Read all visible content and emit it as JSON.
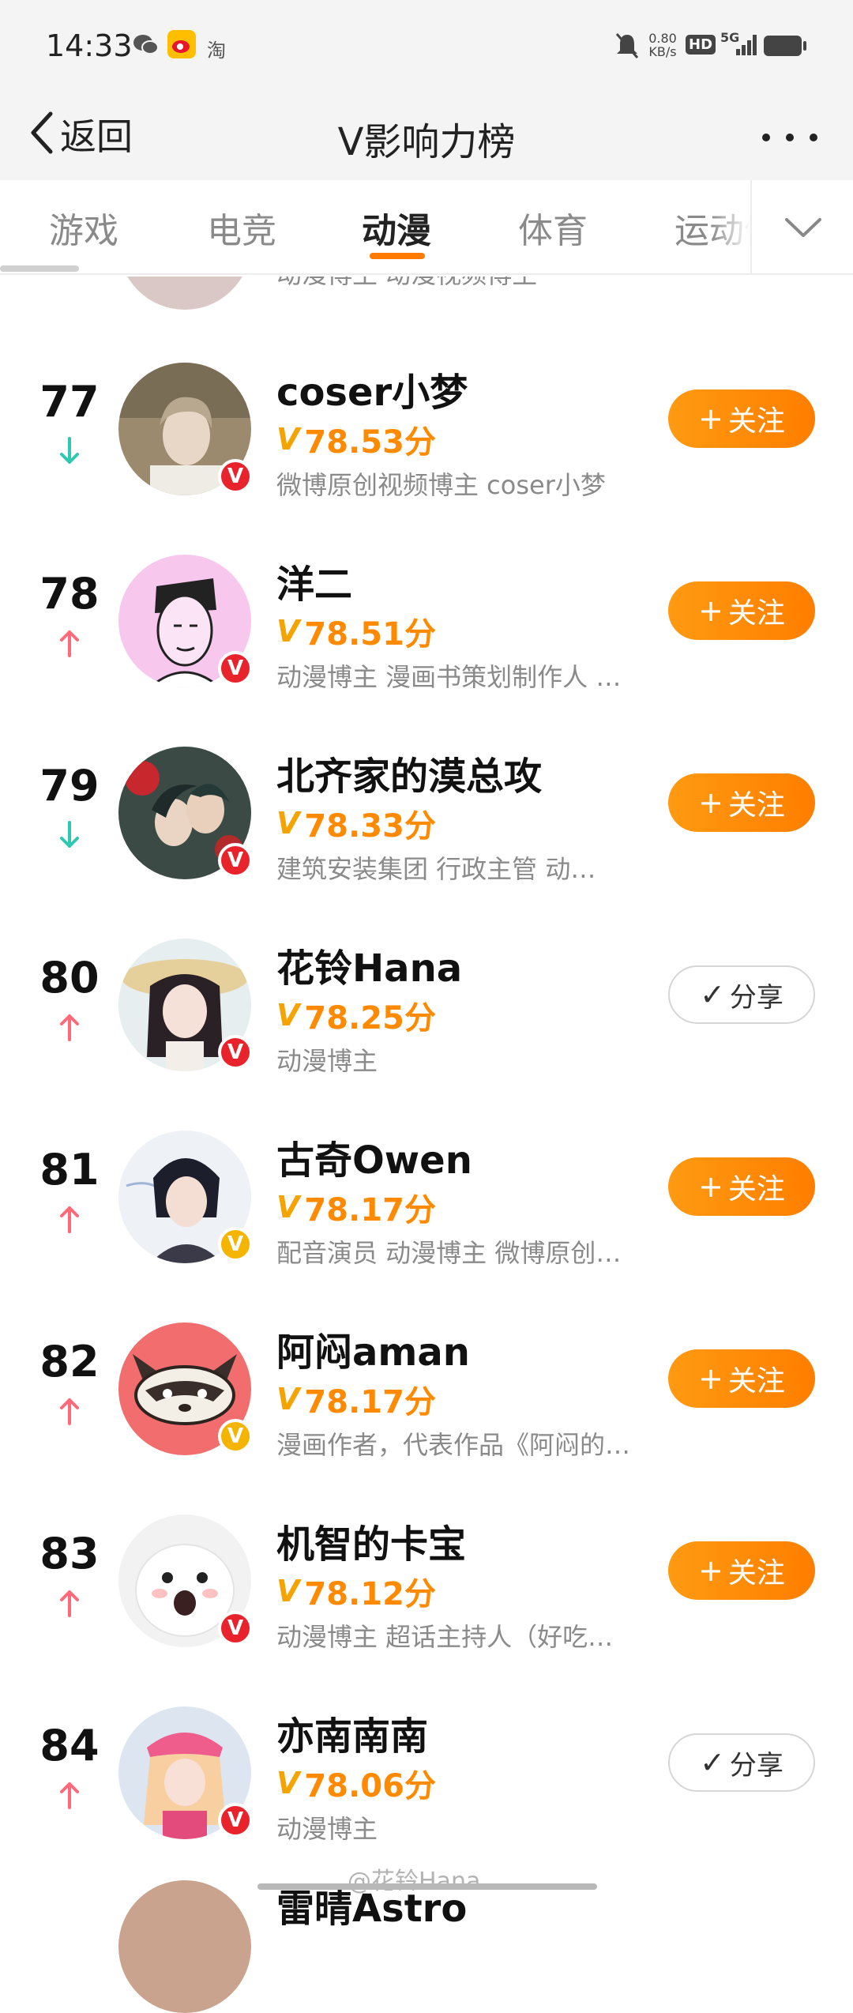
{
  "status_bar": {
    "time": "14:33",
    "net_speed": "0.80",
    "net_unit": "KB/s",
    "hd_label": "HD",
    "signal_label": "5G",
    "app_icon_taobao": "淘"
  },
  "header": {
    "back_label": "返回",
    "title": "V影响力榜"
  },
  "tabs": [
    {
      "label": "游戏"
    },
    {
      "label": "电竞"
    },
    {
      "label": "动漫",
      "active": true
    },
    {
      "label": "体育"
    },
    {
      "label": "运动健"
    }
  ],
  "partial_top": {
    "desc": "动漫博主 动漫视频博主"
  },
  "entries": [
    {
      "rank": "77",
      "trend": "down",
      "name": "coser小梦",
      "score": "78.53分",
      "desc": "微博原创视频博主 coser小梦",
      "badge": "red",
      "button": "follow",
      "avatar": "portrait-boy"
    },
    {
      "rank": "78",
      "trend": "up",
      "name": "洋二",
      "score": "78.51分",
      "desc": "动漫博主 漫画书策划制作人 …",
      "badge": "red",
      "button": "follow",
      "avatar": "sketch-face"
    },
    {
      "rank": "79",
      "trend": "down",
      "name": "北齐家的漠总攻",
      "score": "78.33分",
      "desc": " 建筑安装集团 行政主管 动…",
      "badge": "red",
      "button": "follow",
      "avatar": "anime-couple"
    },
    {
      "rank": "80",
      "trend": "up",
      "name": "花铃Hana",
      "score": "78.25分",
      "desc": "动漫博主",
      "badge": "red",
      "button": "share",
      "avatar": "cosplay-girl"
    },
    {
      "rank": "81",
      "trend": "up",
      "name": "古奇Owen",
      "score": "78.17分",
      "desc": "配音演员 动漫博主 微博原创…",
      "badge": "gold",
      "button": "follow",
      "avatar": "anime-boy"
    },
    {
      "rank": "82",
      "trend": "up",
      "name": "阿闷aman",
      "score": "78.17分",
      "desc": "漫画作者，代表作品《阿闷的…",
      "badge": "gold",
      "button": "follow",
      "avatar": "raccoon"
    },
    {
      "rank": "83",
      "trend": "up",
      "name": "机智的卡宝",
      "score": "78.12分",
      "desc": "动漫博主 超话主持人（好吃…",
      "badge": "red",
      "button": "follow",
      "avatar": "white-dog"
    },
    {
      "rank": "84",
      "trend": "up",
      "name": "亦南南南",
      "score": "78.06分",
      "desc": "动漫博主",
      "badge": "red",
      "button": "share",
      "avatar": "pink-cosplay"
    }
  ],
  "labels": {
    "follow": "关注",
    "follow_glyph": "+",
    "share": "分享",
    "share_glyph": "✓",
    "score_prefix": "V",
    "badge_letter": "V"
  },
  "partial_bottom": {
    "name": "雷晴Astro"
  },
  "watermark": "@花铃Hana",
  "colors": {
    "accent": "#ff8a00",
    "trend_up": "#ff6a7a",
    "trend_down": "#2ec9b0",
    "badge_red": "#e8232b",
    "badge_gold": "#f5b400"
  }
}
